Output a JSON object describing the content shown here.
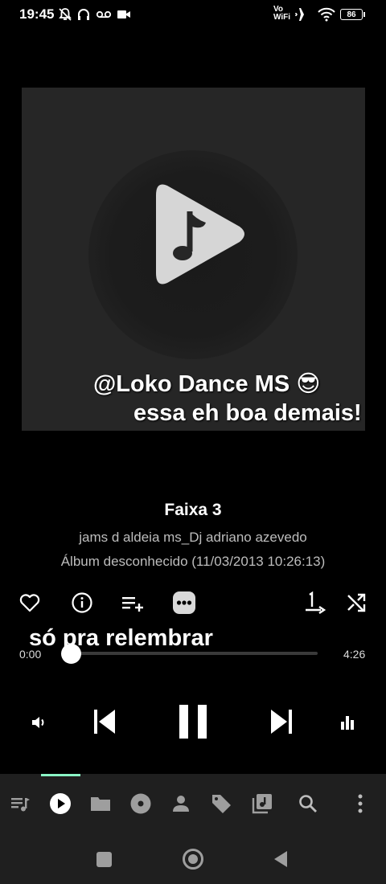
{
  "status_bar": {
    "time": "19:45",
    "volte_line1": "Vo",
    "volte_line2": "WiFi",
    "battery": "86"
  },
  "artwork": {
    "overlay_line1": "@Loko Dance MS 😎",
    "overlay_line2": "essa eh boa demais!"
  },
  "track": {
    "title": "Faixa 3",
    "artist": "jams d aldeia ms_Dj adriano azevedo",
    "album": "Álbum desconhecido (11/03/2013 10:26:13)"
  },
  "caption": "só pra relembrar",
  "seek": {
    "elapsed": "0:00",
    "total": "4:26",
    "progress": 0.0
  },
  "actions": [
    "heart-icon",
    "info-icon",
    "add-to-queue-icon",
    "more-icon",
    "repeat-one-icon",
    "shuffle-icon"
  ],
  "bottom_nav": [
    "queue-icon",
    "now-playing-icon",
    "folder-icon",
    "album-icon",
    "artist-icon",
    "tag-icon",
    "library-icon",
    "search-icon",
    "overflow-icon"
  ],
  "colors": {
    "accent": "#8af5c6",
    "nav_background": "#1f1f1f",
    "artwork_background": "#262626"
  }
}
